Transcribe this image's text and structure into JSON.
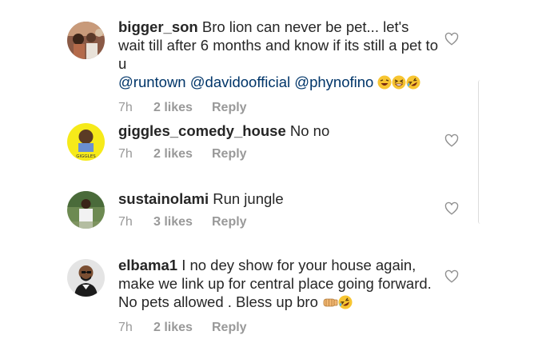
{
  "comments": [
    {
      "username": "bigger_son",
      "text": "Bro lion can never be pet... let's wait till after 6 months and know if its still a pet to u",
      "mentions": [
        "@runtown",
        "@davidoofficial",
        "@phynofino"
      ],
      "emojis": [
        "laughing-face-emoji",
        "grinning-squint-emoji",
        "rofl-emoji"
      ],
      "time": "7h",
      "likes": "2 likes",
      "reply": "Reply"
    },
    {
      "username": "giggles_comedy_house",
      "text": "No no",
      "time": "7h",
      "likes": "2 likes",
      "reply": "Reply"
    },
    {
      "username": "sustainolami",
      "text": "Run jungle",
      "time": "7h",
      "likes": "3 likes",
      "reply": "Reply"
    },
    {
      "username": "elbama1",
      "text": "I no dey show for your house again, make we link up for central place going forward. No pets allowed . Bless up bro",
      "emojis": [
        "fist-bump-emoji",
        "rofl-emoji"
      ],
      "time": "7h",
      "likes": "2 likes",
      "reply": "Reply"
    }
  ],
  "avatar_texts": {
    "giggles": "GIGGLES"
  },
  "colors": {
    "text": "#262626",
    "meta": "#999999",
    "mention": "#003569",
    "heart": "#8e8e8e"
  }
}
